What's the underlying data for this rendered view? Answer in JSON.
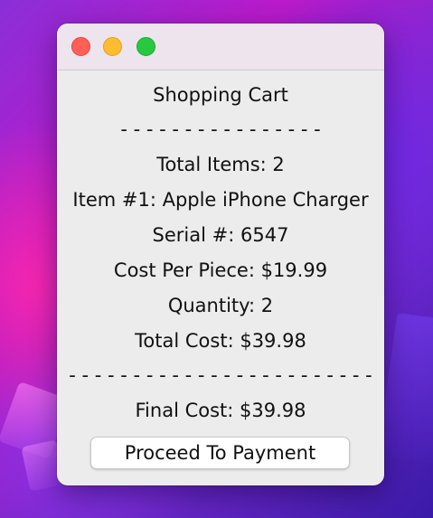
{
  "desktop": {
    "wallpaper_colors": [
      "#8a2fd8",
      "#b91ac9",
      "#3a1aa8"
    ]
  },
  "window": {
    "controls": {
      "close_color": "#ff5f57",
      "minimize_color": "#febc2e",
      "maximize_color": "#28c840"
    },
    "heading": "Shopping Cart",
    "separator_top": "- - - - - - - - - - - - - - - -",
    "total_items": "Total Items: 2",
    "items": [
      {
        "name_line": "Item #1: Apple iPhone Charger",
        "serial_line": "Serial #: 6547",
        "cost_line": "Cost Per Piece: $19.99",
        "quantity_line": "Quantity: 2",
        "total_line": "Total Cost: $39.98"
      }
    ],
    "separator_bottom": "- - - - - - - - - - - - - - - - - - - - - - - -",
    "final_cost": "Final Cost: $39.98",
    "proceed_button_label": "Proceed To Payment"
  }
}
